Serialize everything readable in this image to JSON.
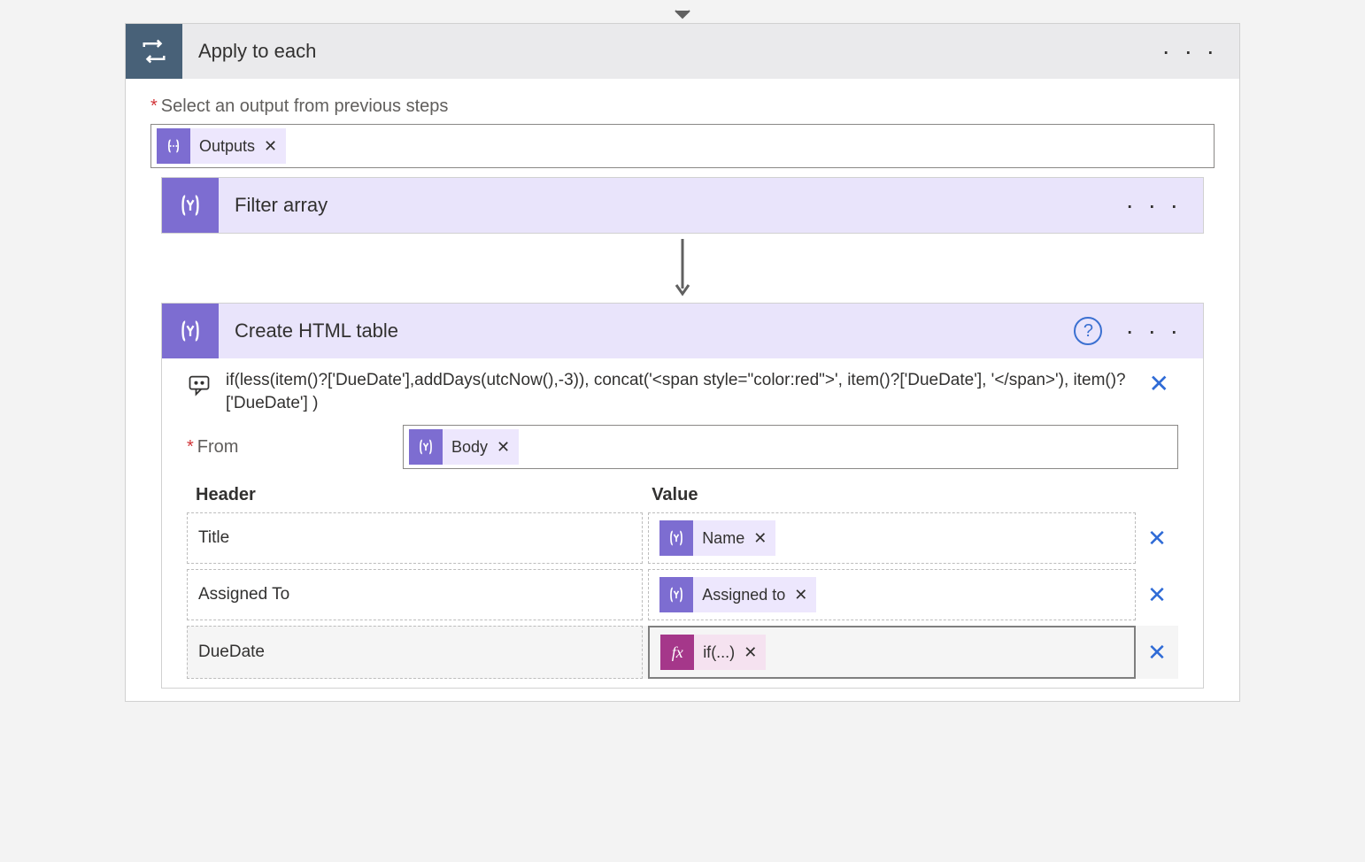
{
  "outer_action": {
    "title": "Apply to each",
    "select_output_label": "Select an output from previous steps",
    "output_token": "Outputs"
  },
  "filter_action": {
    "title": "Filter array"
  },
  "html_table_action": {
    "title": "Create HTML table",
    "tooltip_text": "if(less(item()?['DueDate'],addDays(utcNow(),-3)), concat('<span style=\"color:red\">', item()?['DueDate'], '</span>'), item()?['DueDate'] )",
    "from_label": "From",
    "from_token": "Body",
    "columns_header_label": "Header",
    "columns_value_label": "Value",
    "rows": [
      {
        "header": "Title",
        "value_token": "Name",
        "value_type": "dynamic"
      },
      {
        "header": "Assigned To",
        "value_token": "Assigned to",
        "value_type": "dynamic"
      },
      {
        "header": "DueDate",
        "value_token": "if(...)",
        "value_type": "fx"
      }
    ]
  }
}
